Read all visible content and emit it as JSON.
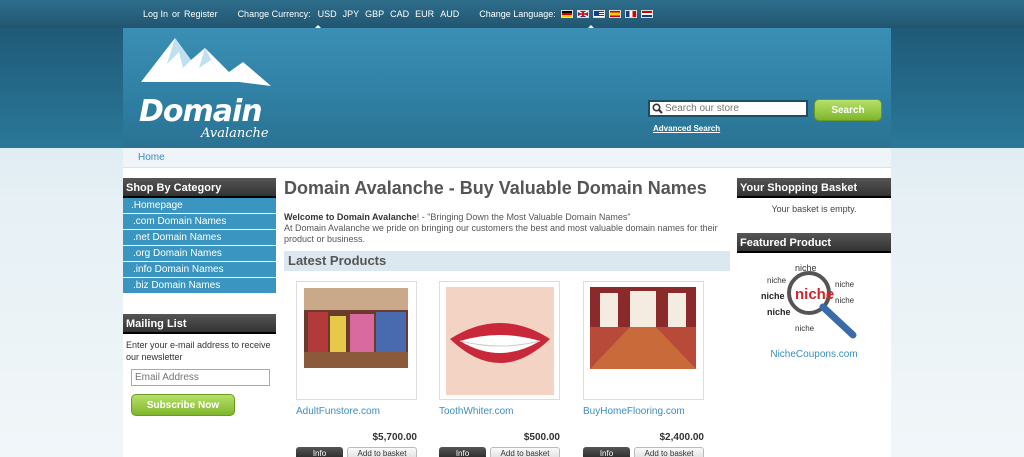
{
  "topbar": {
    "login": "Log In",
    "or": "or",
    "register": "Register",
    "currency_label": "Change Currency:",
    "currencies": [
      "USD",
      "JPY",
      "GBP",
      "CAD",
      "EUR",
      "AUD"
    ],
    "selected_currency": "USD",
    "language_label": "Change Language:",
    "languages": [
      "German",
      "English (UK)",
      "English (US)",
      "Spanish",
      "French",
      "Dutch"
    ],
    "selected_language": "English (US)"
  },
  "header": {
    "logo_word": "Domain",
    "logo_sub": "Avalanche",
    "search_placeholder": "Search our store",
    "search_button": "Search",
    "advanced_search": "Advanced Search"
  },
  "breadcrumb": {
    "home": "Home"
  },
  "categories": {
    "title": "Shop By Category",
    "items": [
      ".Homepage",
      ".com Domain Names",
      ".net Domain Names",
      ".org Domain Names",
      ".info Domain Names",
      ".biz Domain Names"
    ]
  },
  "mailing": {
    "title": "Mailing List",
    "text": "Enter your e-mail address to receive our newsletter",
    "email_placeholder": "Email Address",
    "subscribe": "Subscribe Now"
  },
  "main": {
    "title": "Domain Avalanche - Buy Valuable Domain Names",
    "welcome_bold": "Welcome to Domain Avalanche",
    "welcome_rest": "! - \"Bringing Down the Most Valuable Domain Names\"",
    "welcome_body": "At Domain Avalanche we pride on bringing our customers the best and most valuable domain names for their product or business.",
    "latest_title": "Latest Products",
    "products": [
      {
        "name": "AdultFunstore.com",
        "price": "$5,700.00",
        "info": "Info",
        "add": "Add to basket"
      },
      {
        "name": "ToothWhiter.com",
        "price": "$500.00",
        "info": "Info",
        "add": "Add to basket"
      },
      {
        "name": "BuyHomeFlooring.com",
        "price": "$2,400.00",
        "info": "Info",
        "add": "Add to basket"
      }
    ]
  },
  "basket": {
    "title": "Your Shopping Basket",
    "text": "Your basket is empty."
  },
  "featured": {
    "title": "Featured Product",
    "link": "NicheCoupons.com",
    "image_words": [
      "niche",
      "niche",
      "niche",
      "niche",
      "niche",
      "niche",
      "niche"
    ]
  },
  "colors": {
    "accent_blue": "#3a95c1",
    "green_button": "#7fb52c",
    "header_blue": "#2f7fa3"
  }
}
